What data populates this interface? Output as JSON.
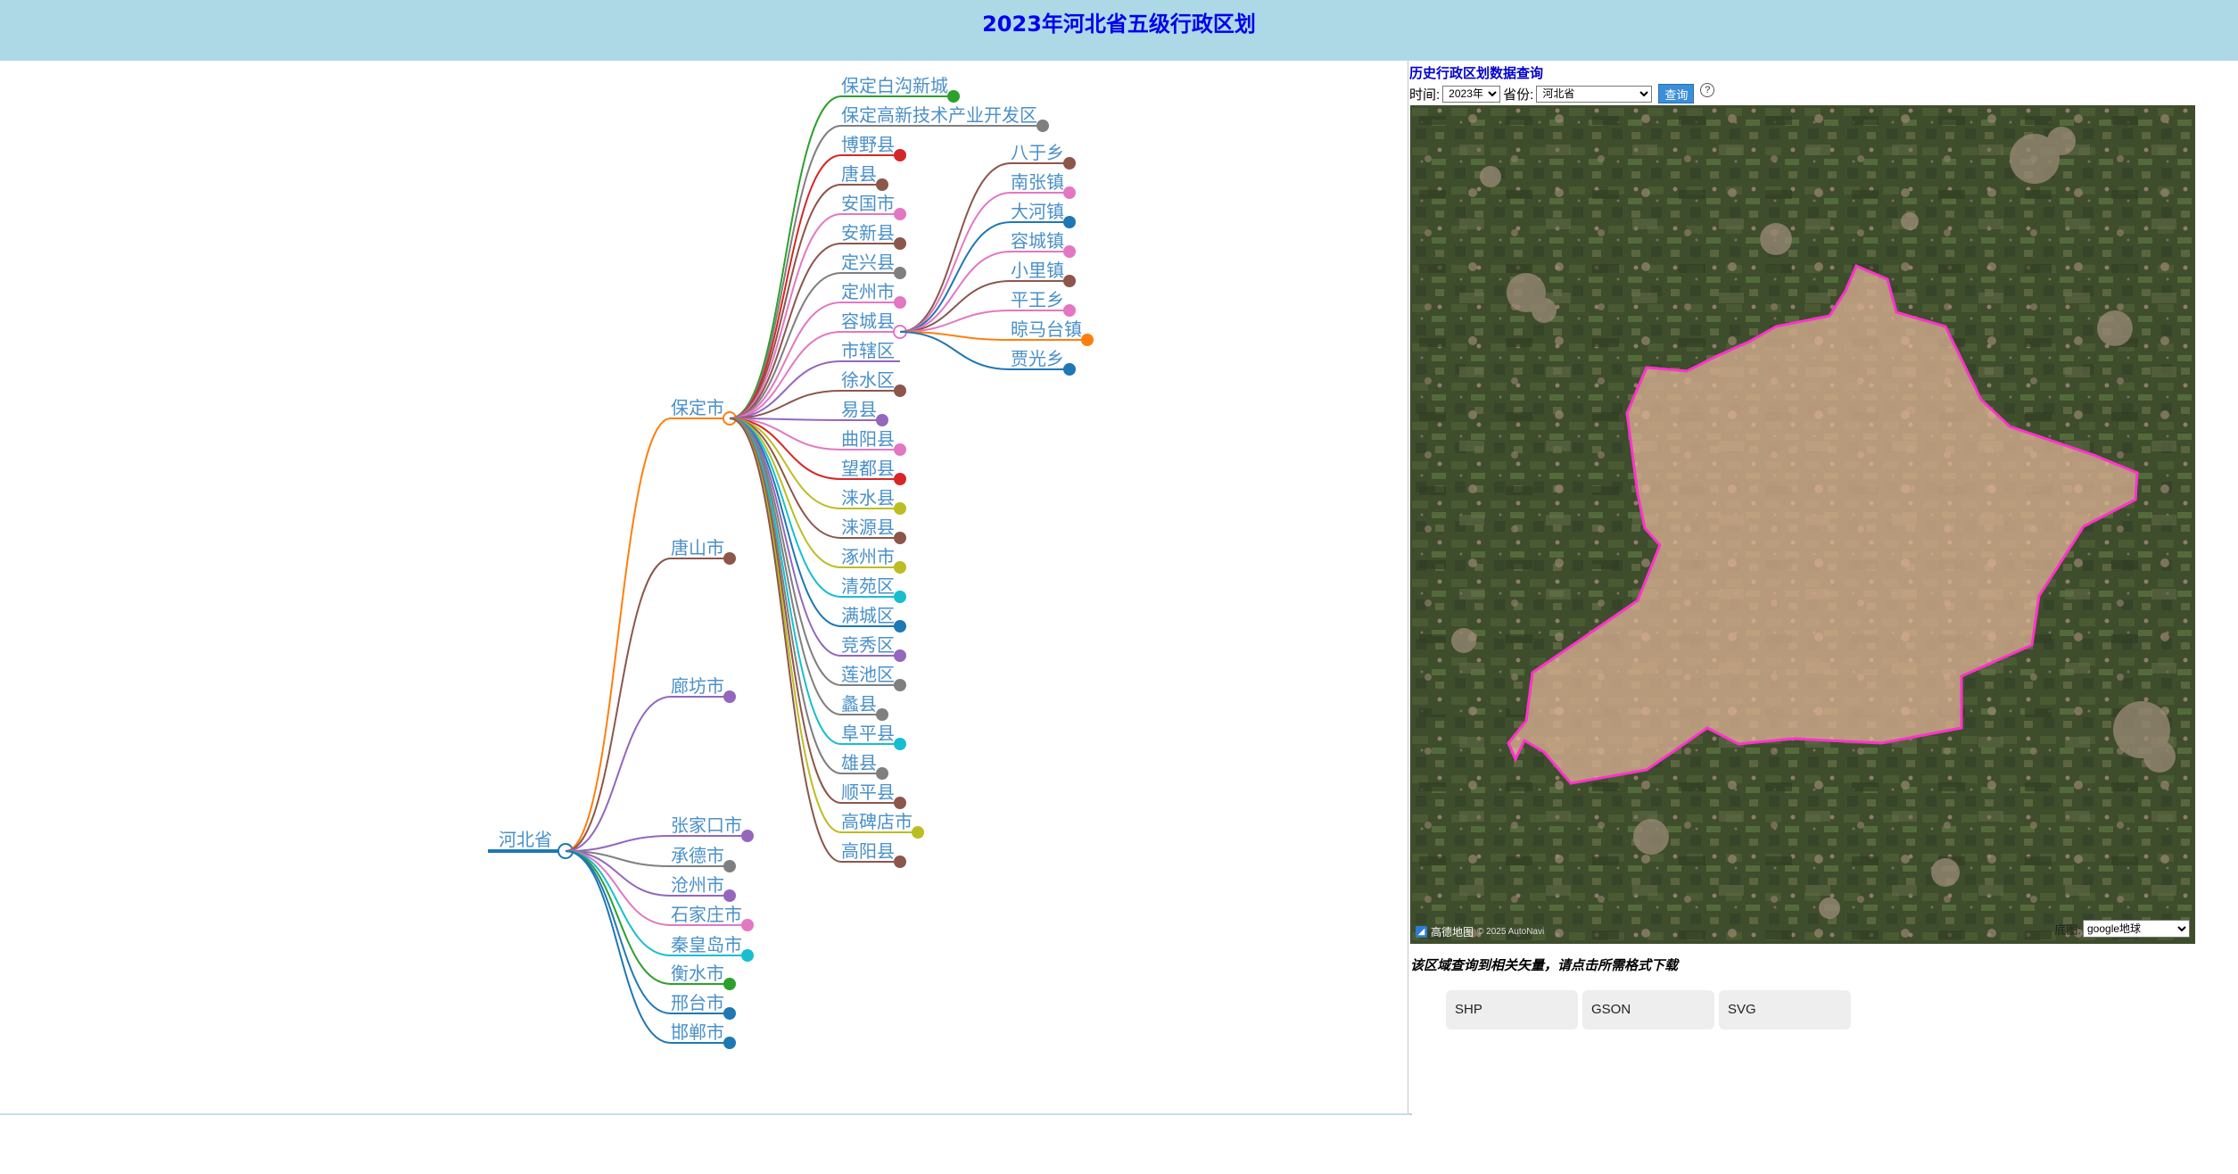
{
  "page": {
    "title": "2023年河北省五级行政区划"
  },
  "tree": {
    "root": "河北省",
    "cities": [
      "保定市",
      "唐山市",
      "廊坊市",
      "张家口市",
      "承德市",
      "沧州市",
      "石家庄市",
      "秦皇岛市",
      "衡水市",
      "邢台市",
      "邯郸市"
    ],
    "baoding_children": [
      "保定白沟新城",
      "保定高新技术产业开发区",
      "博野县",
      "唐县",
      "安国市",
      "安新县",
      "定兴县",
      "定州市",
      "容城县",
      "市辖区",
      "徐水区",
      "易县",
      "曲阳县",
      "望都县",
      "涞水县",
      "涞源县",
      "涿州市",
      "清苑区",
      "满城区",
      "竞秀区",
      "莲池区",
      "蠡县",
      "阜平县",
      "雄县",
      "顺平县",
      "高碑店市",
      "高阳县"
    ],
    "rongcheng_children": [
      "八于乡",
      "南张镇",
      "大河镇",
      "容城镇",
      "小里镇",
      "平王乡",
      "晾马台镇",
      "贾光乡"
    ],
    "colors": {
      "cities": [
        "#ff7f0e",
        "#8c564b",
        "#9467bd",
        "#9467bd",
        "#7f7f7f",
        "#9467bd",
        "#e377c2",
        "#17becf",
        "#2ca02c",
        "#1f77b4",
        "#1f77b4"
      ],
      "baoding_children": [
        "#2ca02c",
        "#7f7f7f",
        "#d62728",
        "#8c564b",
        "#e377c2",
        "#8c564b",
        "#7f7f7f",
        "#e377c2",
        "#e377c2",
        "#9467bd",
        "#8c564b",
        "#9467bd",
        "#e377c2",
        "#d62728",
        "#bcbd22",
        "#8c564b",
        "#bcbd22",
        "#17becf",
        "#1f77b4",
        "#9467bd",
        "#7f7f7f",
        "#7f7f7f",
        "#17becf",
        "#7f7f7f",
        "#8c564b",
        "#bcbd22",
        "#8c564b"
      ],
      "rongcheng_children": [
        "#8c564b",
        "#e377c2",
        "#1f77b4",
        "#e377c2",
        "#8c564b",
        "#e377c2",
        "#ff7f0e",
        "#1f77b4"
      ],
      "root_line": "#1f77b4",
      "label": "#4a90c8"
    }
  },
  "panel": {
    "title": "历史行政区划数据查询",
    "time_label": "时间:",
    "time_value": "2023年",
    "province_label": "省份:",
    "province_value": "河北省",
    "query_button": "查询",
    "help_icon": "?"
  },
  "map": {
    "attribution": "高德地图",
    "copyright": "© 2025 AutoNavi",
    "basemap_label": "底图:",
    "basemap_value": "google地球",
    "highlight_color": "#ff33cc"
  },
  "download": {
    "notice": "该区域查询到相关矢量，请点击所需格式下载",
    "buttons": [
      "SHP",
      "GSON",
      "SVG"
    ]
  }
}
